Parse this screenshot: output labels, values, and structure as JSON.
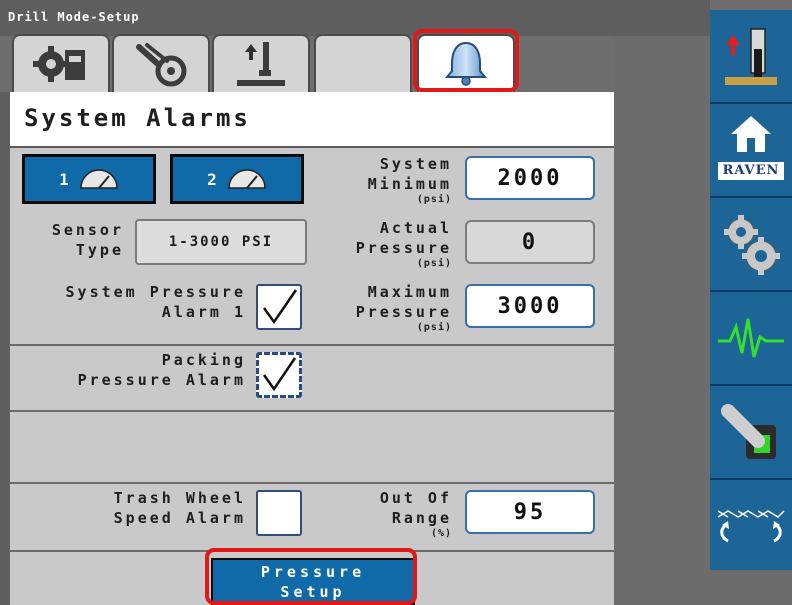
{
  "window": {
    "title": "Drill Mode-Setup"
  },
  "tabs": [
    {
      "icon": "machine-config-icon"
    },
    {
      "icon": "wheel-arm-icon"
    },
    {
      "icon": "implement-lift-icon"
    },
    {
      "icon": ""
    },
    {
      "icon": "bell-icon",
      "active": true
    }
  ],
  "page": {
    "title": "System Alarms"
  },
  "sensors": [
    {
      "label": "1",
      "icon": "gauge-icon"
    },
    {
      "label": "2",
      "icon": "gauge-icon"
    }
  ],
  "fields": {
    "sensor_type": {
      "label_line1": "Sensor",
      "label_line2": "Type",
      "value": "1-3000 PSI"
    },
    "system_minimum": {
      "label_line1": "System",
      "label_line2": "Minimum",
      "unit": "(psi)",
      "value": "2000"
    },
    "actual_pressure": {
      "label_line1": "Actual",
      "label_line2": "Pressure",
      "unit": "(psi)",
      "value": "0"
    },
    "maximum_pressure": {
      "label_line1": "Maximum",
      "label_line2": "Pressure",
      "unit": "(psi)",
      "value": "3000"
    },
    "out_of_range": {
      "label_line1": "Out Of",
      "label_line2": "Range",
      "unit": "(%)",
      "value": "95"
    }
  },
  "alarms": {
    "system_pressure": {
      "label_line1": "System Pressure",
      "label_line2": "Alarm 1",
      "checked": true
    },
    "packing_pressure": {
      "label_line1": "Packing",
      "label_line2": "Pressure Alarm",
      "checked": true
    },
    "trash_wheel_speed": {
      "label_line1": "Trash Wheel",
      "label_line2": "Speed Alarm",
      "checked": false
    }
  },
  "buttons": {
    "pressure_setup": {
      "line1": "Pressure",
      "line2": "Setup"
    }
  },
  "sidebar": {
    "items": [
      {
        "icon": "lift-raise-icon"
      },
      {
        "icon": "home-icon",
        "brand": "RAVEN"
      },
      {
        "icon": "gears-icon"
      },
      {
        "icon": "diagnostics-waveform-icon"
      },
      {
        "icon": "switch-toggle-icon"
      },
      {
        "icon": "section-control-icon"
      }
    ]
  },
  "colors": {
    "primary_blue": "#0f6aa7",
    "sidebar_blue": "#1c6596",
    "highlight_red": "#e01818",
    "panel_gray": "#c9c9c9"
  }
}
